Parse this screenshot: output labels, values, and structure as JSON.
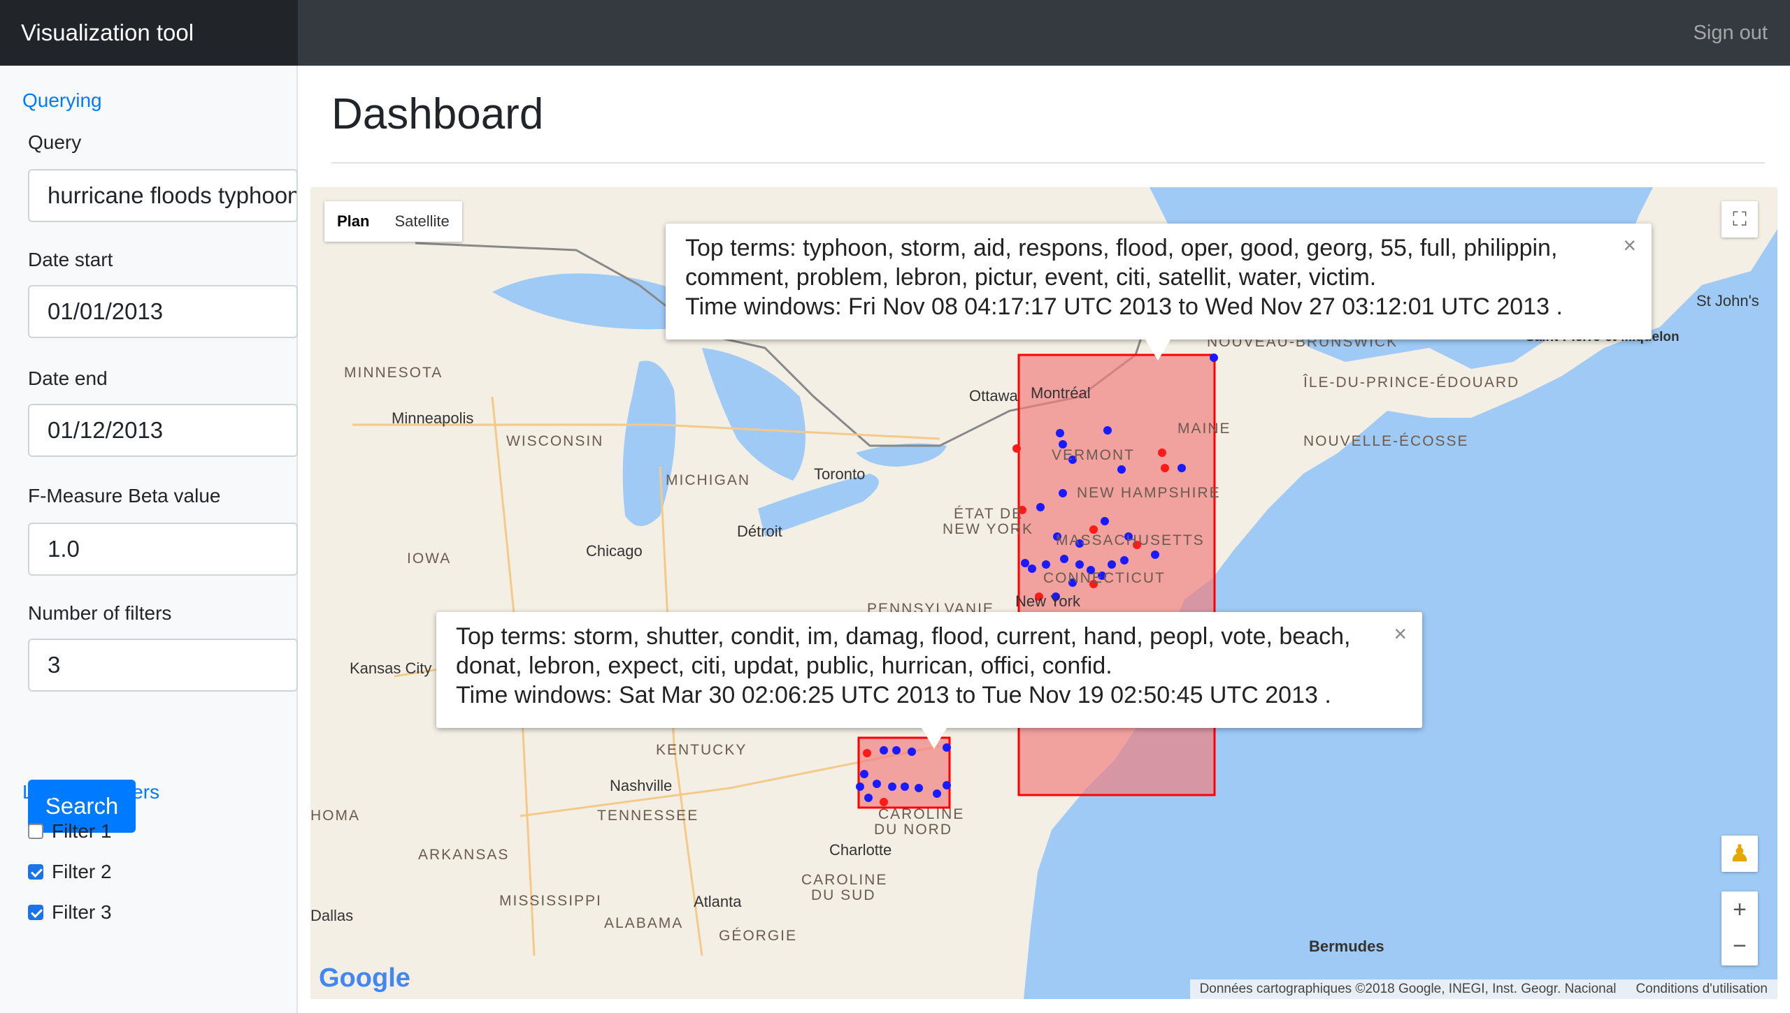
{
  "navbar": {
    "brand": "Visualization tool",
    "signout": "Sign out"
  },
  "sidebar": {
    "querying_link": "Querying",
    "query_label": "Query",
    "query_value": "hurricane floods typhoon",
    "date_start_label": "Date start",
    "date_start_value": "01/01/2013",
    "date_end_label": "Date end",
    "date_end_value": "01/12/2013",
    "beta_label": "F-Measure Beta value",
    "beta_value": "1.0",
    "filters_label": "Number of filters",
    "filters_value": "3",
    "search_label": "Search",
    "top_filters_link": "List of top filters",
    "filters": [
      {
        "label": "Filter 1",
        "checked": false
      },
      {
        "label": "Filter 2",
        "checked": true
      },
      {
        "label": "Filter 3",
        "checked": true
      }
    ]
  },
  "main": {
    "title": "Dashboard"
  },
  "map": {
    "map_type_plan": "Plan",
    "map_type_satellite": "Satellite",
    "google_logo": "Google",
    "attribution": "Données cartographiques ©2018 Google, INEGI, Inst. Geogr. Nacional",
    "terms": "Conditions d'utilisation",
    "places": {
      "minneapolis": "Minneapolis",
      "chicago": "Chicago",
      "detroit": "Détroit",
      "toronto": "Toronto",
      "ottawa": "Ottawa",
      "montreal": "Montréal",
      "kansas_city": "Kansas City",
      "nashville": "Nashville",
      "atlanta": "Atlanta",
      "charlotte": "Charlotte",
      "dallas": "Dallas",
      "new_york": "New York",
      "st_johns": "St John's",
      "saint_pierre": "Saint-Pierre-et-Miquelon",
      "bermudes": "Bermudes"
    },
    "regions": {
      "minnesota": "MINNESOTA",
      "wisconsin": "WISCONSIN",
      "michigan": "MICHIGAN",
      "iowa": "IOWA",
      "etat_ny": "ÉTAT DE",
      "etat_ny2": "NEW YORK",
      "vermont": "VERMONT",
      "new_hampshire": "NEW HAMPSHIRE",
      "maine": "MAINE",
      "massachusetts": "MASSACHUSETTS",
      "connecticut": "CONNECTICUT",
      "pennsylvanie": "PENNSYLVANIE",
      "kentucky": "KENTUCKY",
      "tennessee": "TENNESSEE",
      "arkansas": "ARKANSAS",
      "mississippi": "MISSISSIPPI",
      "alabama": "ALABAMA",
      "georgie": "GÉORGIE",
      "caroline_nord": "CAROLINE",
      "caroline_nord2": "DU NORD",
      "caroline_sud": "CAROLINE",
      "caroline_sud2": "DU SUD",
      "oklahoma": "HOMA",
      "nouveau_brunswick": "NOUVEAU-BRUNSWICK",
      "ile_prince": "ÎLE-DU-PRINCE-ÉDOUARD",
      "nouvelle_ecosse": "NOUVELLE-ÉCOSSE"
    },
    "info_windows": [
      {
        "terms_label": "Top terms:",
        "terms": "typhoon, storm, aid, respons, flood, oper, good, georg, 55, full, philippin, comment, problem, lebron, pictur, event, citi, satellit, water, victim.",
        "time_label": "Time windows:",
        "time_start": "Fri Nov 08 04:17:17 UTC 2013",
        "to": "to",
        "time_end": "Wed Nov 27 03:12:01 UTC 2013 .",
        "close": "×"
      },
      {
        "terms_label": "Top terms:",
        "terms": "storm, shutter, condit, im, damag, flood, current, hand, peopl, vote, beach, donat, lebron, expect, citi, updat, public, hurrican, offici, confid.",
        "time_label": "Time windows:",
        "time_start": "Sat Mar 30 02:06:25 UTC 2013",
        "to": "to",
        "time_end": "Tue Nov 19 02:50:45 UTC 2013 .",
        "close": "×"
      }
    ],
    "colors": {
      "rect_fill": "#f08080",
      "rect_stroke": "#ff0000",
      "dot_blue": "#1a1aff",
      "dot_red": "#ff1a1a",
      "land": "#f3efe4",
      "water": "#9ecaf5"
    }
  }
}
